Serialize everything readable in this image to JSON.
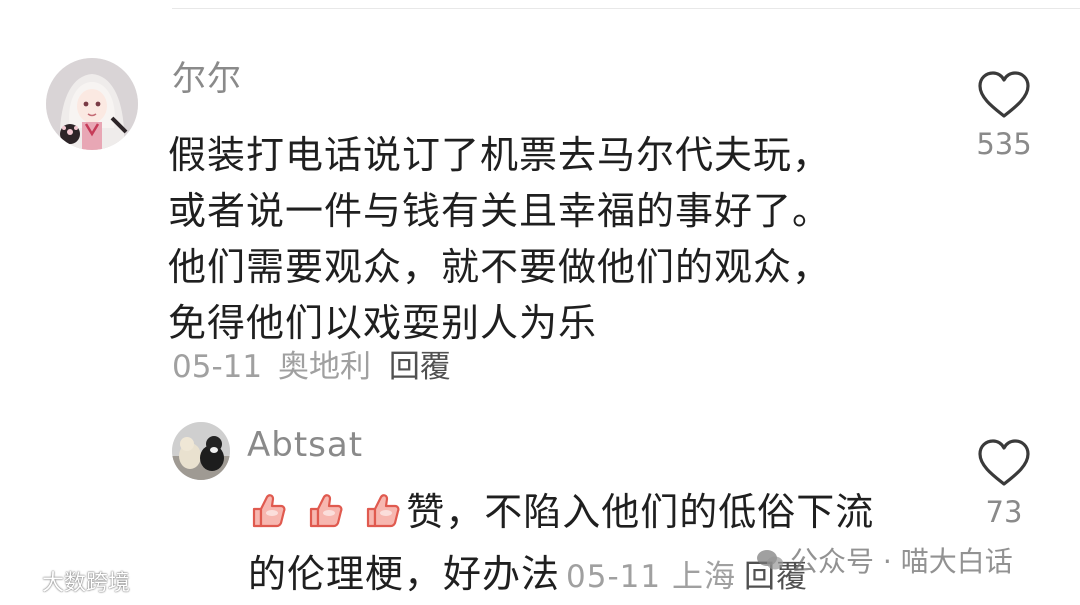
{
  "comments": [
    {
      "username": "尔尔",
      "text_lines": [
        "假装打电话说订了机票去马尔代夫玩，",
        "或者说一件与钱有关且幸福的事好了。",
        "他们需要观众，就不要做他们的观众，",
        "免得他们以戏耍别人为乐"
      ],
      "date": "05-11",
      "location": "奥地利",
      "reply_label": "回覆",
      "like_count": "535",
      "avatar_icon": "anime-girl-avatar"
    }
  ],
  "reply": {
    "username": "Abtsat",
    "text_prefix": "赞，不陷入他们的低俗下流",
    "text_line2": "的伦理梗，好办法",
    "emoji_icon": "thumbs-up-emoji",
    "emoji_count": 3,
    "date": "05-11",
    "location": "上海",
    "reply_label": "回覆",
    "like_count": "73",
    "avatar_icon": "cats-avatar"
  },
  "watermarks": {
    "left": "大数跨境",
    "right": "公众号 · 喵大白话"
  },
  "colors": {
    "text": "#1f1f1f",
    "muted": "#8a8a8a",
    "meta": "#a0a0a0",
    "reply_link": "#505050",
    "emoji_fill": "#f7b7b0",
    "emoji_stroke": "#e05a4f"
  }
}
